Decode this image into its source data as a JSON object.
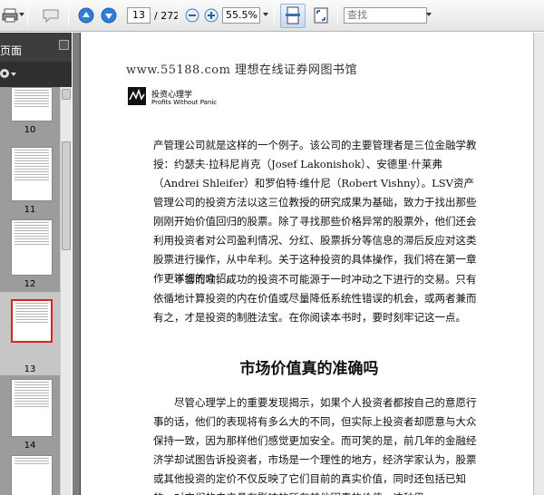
{
  "toolbar": {
    "page_current": "13",
    "page_total": "/ 272",
    "zoom": "55.5%",
    "search_placeholder": "查找"
  },
  "sidebar": {
    "title": "页面",
    "thumbnails": [
      {
        "label": "10"
      },
      {
        "label": "11"
      },
      {
        "label": "12"
      },
      {
        "label": "13",
        "selected": true
      },
      {
        "label": "14"
      }
    ]
  },
  "document": {
    "header": "www.55188.com 理想在线证券网图书馆",
    "logo_cn": "投资心理学",
    "logo_en": "Profits Without Panic",
    "para1": "产管理公司就是这样的一个例子。该公司的主要管理者是三位金融学教授：约瑟夫·拉科尼肖克（Josef Lakonishok）、安德里·什莱弗（Andrei Shleifer）和罗伯特·维什尼（Robert Vishny）。LSV资产管理公司的投资方法以这三位教授的研究成果为基础，致力于找出那些刚刚开始价值回归的股票。除了寻找那些价格异常的股票外，他们还会利用投资者对公司盈利情况、分红、股票拆分等信息的滞后反应对这类股票进行操作，从中牟利。关于这种投资的具体操作，我们将在第一章作更详细的介绍。",
    "para2": "不言而喻，成功的投资不可能源于一时冲动之下进行的交易。只有依循地计算投资的内在价值或尽量降低系统性错误的机会，或两者兼而有之，才是投资的制胜法宝。在你阅读本书时，要时刻牢记这一点。",
    "section_title": "市场价值真的准确吗",
    "para3": "尽管心理学上的重要发现揭示，如果个人投资者都按自己的意愿行事的话，他们的表现将有多么大的不同，但实际上投资者却愿意与大众保持一致，因为那样他们感觉更加安全。而可笑的是，前几年的金融经济学却试图告诉投资者，市场是一个理性的地方，经济学家认为，股票或其他投资的定价不仅反映了它们目前的真实价值，同时还包括已知的、对它们的未来具有影响的所有其他因素的价值。这种思"
  }
}
